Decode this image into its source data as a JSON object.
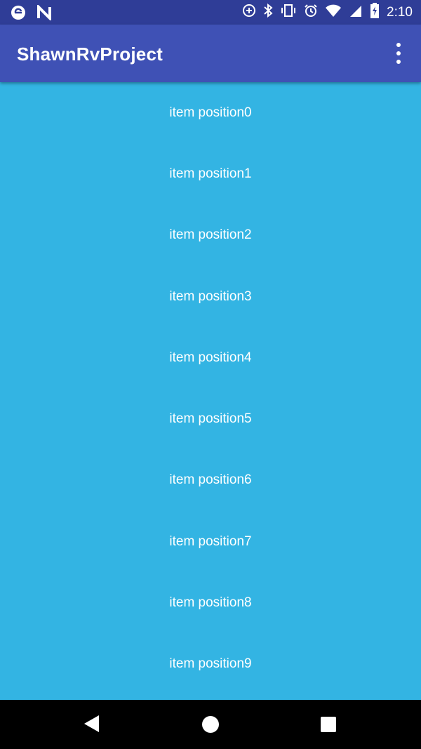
{
  "status_bar": {
    "time": "2:10",
    "left_icons": [
      "e-browser-icon",
      "n-notification-icon"
    ],
    "right_icons": [
      "data-saver-icon",
      "bluetooth-icon",
      "vibrate-icon",
      "alarm-icon",
      "wifi-icon",
      "signal-icon",
      "battery-charging-icon"
    ]
  },
  "app_bar": {
    "title": "ShawnRvProject",
    "menu_icon": "overflow-menu-icon"
  },
  "list": {
    "items": [
      "item position0",
      "item position1",
      "item position2",
      "item position3",
      "item position4",
      "item position5",
      "item position6",
      "item position7",
      "item position8",
      "item position9"
    ]
  },
  "nav_bar": {
    "icons": [
      "back-icon",
      "home-icon",
      "recents-icon"
    ]
  },
  "colors": {
    "status_bar": "#2f3d97",
    "app_bar": "#3f51b5",
    "list_background": "#33b4e3",
    "nav_bar": "#000000",
    "text": "#ffffff"
  }
}
